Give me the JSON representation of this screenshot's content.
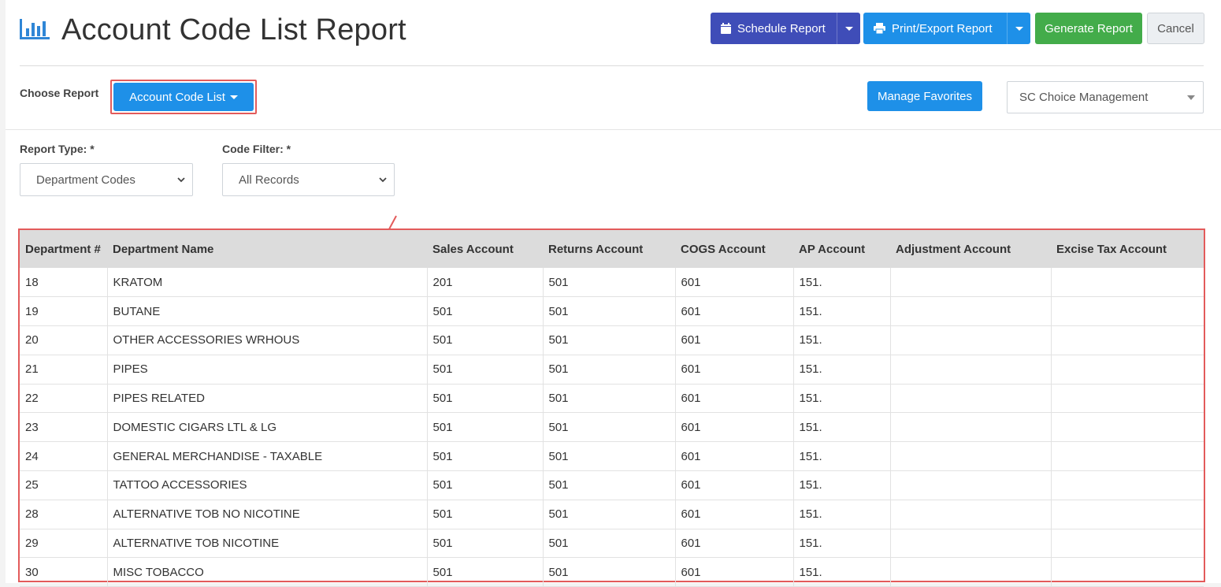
{
  "header": {
    "title": "Account Code List Report",
    "schedule_label": "Schedule Report",
    "print_label": "Print/Export Report",
    "generate_label": "Generate Report",
    "cancel_label": "Cancel"
  },
  "chooser": {
    "label": "Choose Report",
    "selected_report": "Account Code List",
    "favorites_label": "Manage Favorites",
    "company": "SC Choice Management"
  },
  "filters": {
    "report_type_label": "Report Type: *",
    "report_type_value": "Department Codes",
    "code_filter_label": "Code Filter: *",
    "code_filter_value": "All Records"
  },
  "table": {
    "columns": [
      "Department #",
      "Department Name",
      "Sales Account",
      "Returns Account",
      "COGS Account",
      "AP Account",
      "Adjustment Account",
      "Excise Tax Account"
    ],
    "rows": [
      [
        "18",
        "KRATOM",
        "201",
        "501",
        "601",
        "151.",
        "",
        ""
      ],
      [
        "19",
        "BUTANE",
        "501",
        "501",
        "601",
        "151.",
        "",
        ""
      ],
      [
        "20",
        "OTHER ACCESSORIES WRHOUS",
        "501",
        "501",
        "601",
        "151.",
        "",
        ""
      ],
      [
        "21",
        "PIPES",
        "501",
        "501",
        "601",
        "151.",
        "",
        ""
      ],
      [
        "22",
        "PIPES RELATED",
        "501",
        "501",
        "601",
        "151.",
        "",
        ""
      ],
      [
        "23",
        "DOMESTIC CIGARS LTL & LG",
        "501",
        "501",
        "601",
        "151.",
        "",
        ""
      ],
      [
        "24",
        "GENERAL MERCHANDISE - TAXABLE",
        "501",
        "501",
        "601",
        "151.",
        "",
        ""
      ],
      [
        "25",
        "TATTOO ACCESSORIES",
        "501",
        "501",
        "601",
        "151.",
        "",
        ""
      ],
      [
        "28",
        "ALTERNATIVE TOB NO NICOTINE",
        "501",
        "501",
        "601",
        "151.",
        "",
        ""
      ],
      [
        "29",
        "ALTERNATIVE TOB NICOTINE",
        "501",
        "501",
        "601",
        "151.",
        "",
        ""
      ],
      [
        "30",
        "MISC TOBACCO",
        "501",
        "501",
        "601",
        "151.",
        "",
        ""
      ]
    ]
  },
  "colors": {
    "purple": "#3f4db8",
    "blue": "#1e90e8",
    "green": "#43ac4a",
    "highlight": "#e35b5b"
  },
  "icons": {
    "title": "bar-chart-icon",
    "schedule": "calendar-icon",
    "print": "printer-icon"
  }
}
